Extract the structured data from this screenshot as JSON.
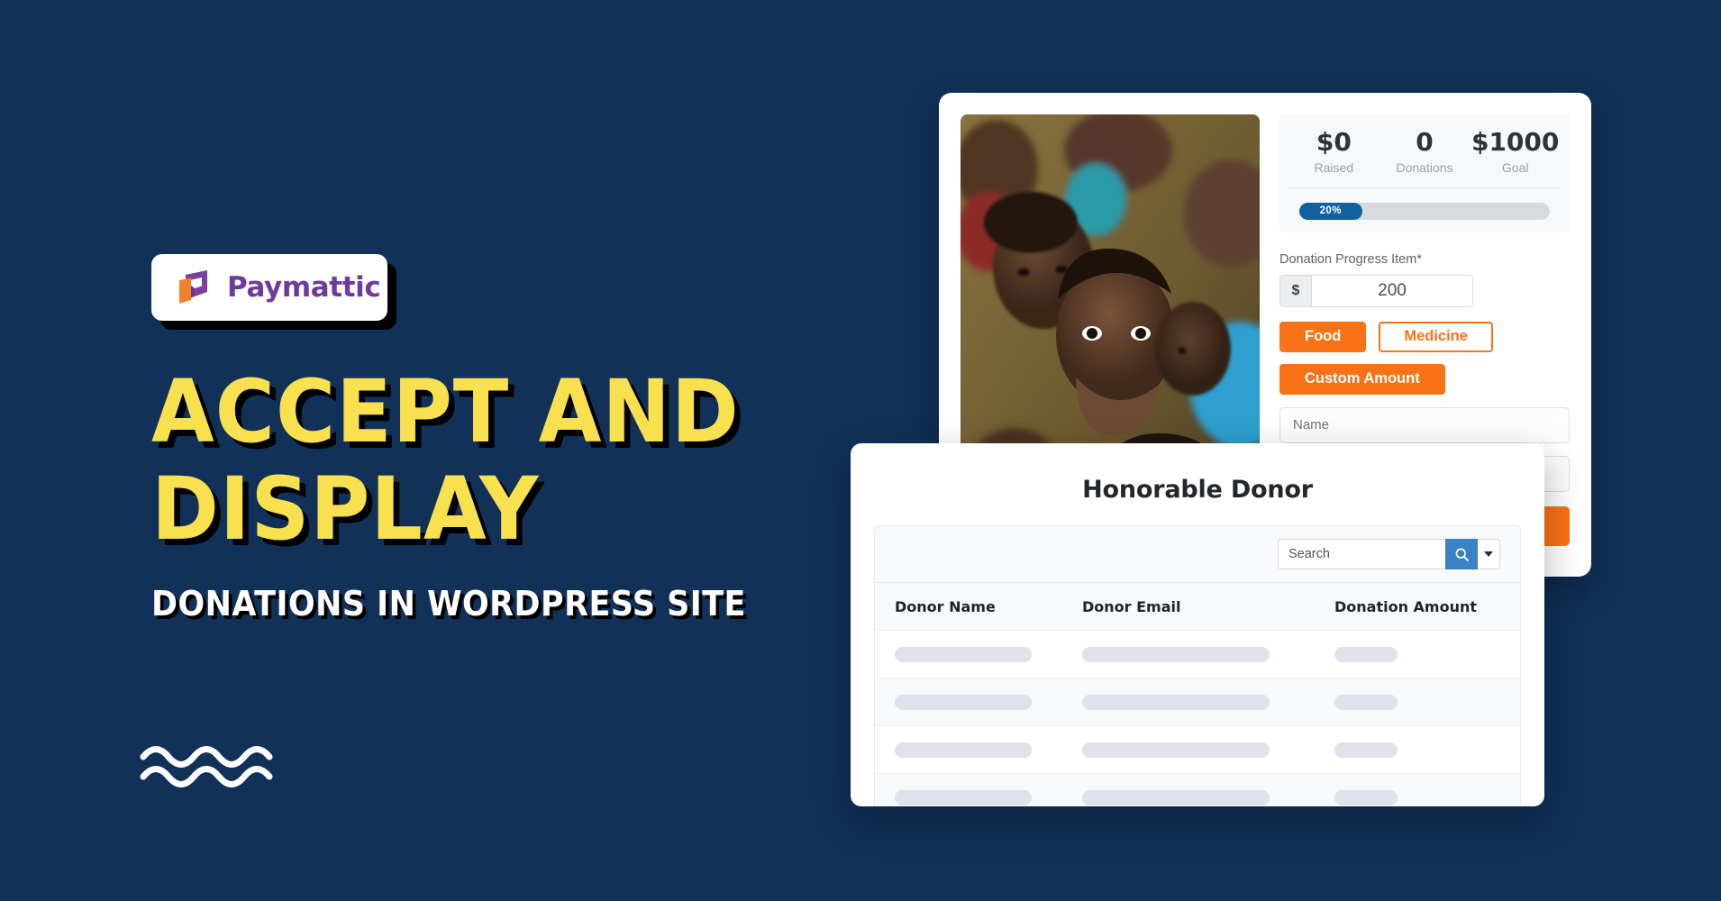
{
  "theme": {
    "background": "#113158",
    "headline_color": "#f9e04e",
    "subheadline_color": "#ffffff",
    "accent_orange": "#f97316",
    "accent_blue": "#11609f",
    "search_blue": "#3b82c4",
    "brand_purple": "#6f3a9e"
  },
  "brand": {
    "logo_icon": "paymattic-logo-icon",
    "name": "Paymattic"
  },
  "hero": {
    "headline_lines": [
      "ACCEPT AND",
      "DISPLAY"
    ],
    "subheadline": "DONATIONS IN WORDPRESS SITE",
    "decoration": "wave-lines-icon"
  },
  "donation_form": {
    "photo_alt": "group-of-children-photo",
    "stats": [
      {
        "value": "$0",
        "label": "Raised"
      },
      {
        "value": "0",
        "label": "Donations"
      },
      {
        "value": "$1000",
        "label": "Goal"
      }
    ],
    "progress": {
      "label": "20%",
      "percent": 20,
      "fill_width": "25%"
    },
    "amount_field": {
      "label": "Donation Progress Item*",
      "currency_prefix": "$",
      "value": "200"
    },
    "preset_buttons": [
      {
        "label": "Food",
        "style": "solid"
      },
      {
        "label": "Medicine",
        "style": "ghost"
      },
      {
        "label": "Custom Amount",
        "style": "solid"
      }
    ],
    "inputs": [
      {
        "placeholder": "Name"
      },
      {
        "placeholder": ""
      }
    ],
    "submit_label": ""
  },
  "donor_card": {
    "title": "Honorable Donor",
    "search": {
      "placeholder": "Search",
      "value": "Search",
      "button_icon": "search-icon",
      "dropdown_icon": "chevron-down-icon"
    },
    "columns": [
      "Donor Name",
      "Donor Email",
      "Donation Amount"
    ],
    "rows": [
      {
        "name": "",
        "email": "",
        "amount": ""
      },
      {
        "name": "",
        "email": "",
        "amount": ""
      },
      {
        "name": "",
        "email": "",
        "amount": ""
      },
      {
        "name": "",
        "email": "",
        "amount": ""
      }
    ]
  }
}
